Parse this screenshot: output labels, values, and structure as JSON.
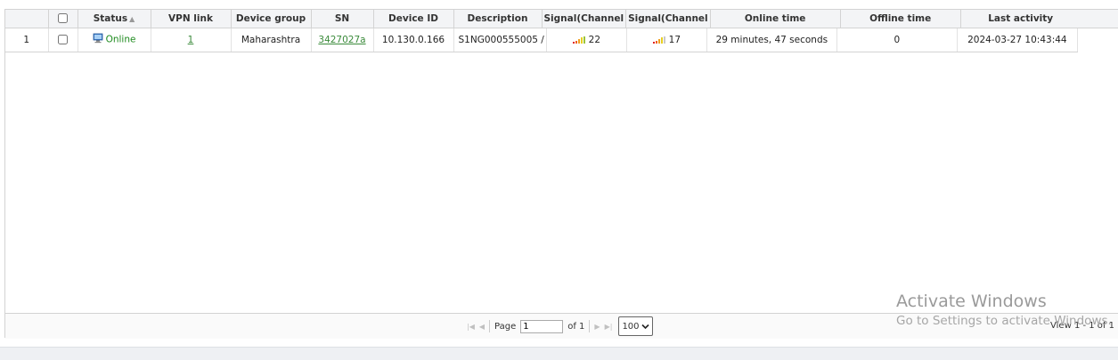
{
  "table": {
    "headers": {
      "num": "",
      "status": "Status",
      "vpn": "VPN link",
      "group": "Device group",
      "sn": "SN",
      "device_id": "Device ID",
      "description": "Description",
      "signal1": "Signal(Channel",
      "signal2": "Signal(Channel",
      "online_time": "Online time",
      "offline_time": "Offline time",
      "last_activity": "Last activity"
    },
    "sort_indicator": "▲",
    "rows": [
      {
        "num": "1",
        "status": "Online",
        "vpn": "1",
        "group": "Maharashtra",
        "sn": "3427027a",
        "device_id": "10.130.0.166",
        "description": "S1NG000555005 /",
        "signal1": "22",
        "signal2": "17",
        "online_time": "29 minutes, 47 seconds",
        "offline_time": "0",
        "last_activity": "2024-03-27 10:43:44"
      }
    ]
  },
  "pager": {
    "page_label": "Page",
    "page_value": "1",
    "of_label": "of 1",
    "page_size": "100",
    "view_info": "View 1 - 1 of 1"
  },
  "watermark": {
    "line1": "Activate Windows",
    "line2": "Go to Settings to activate Windows."
  },
  "colors": {
    "online": "#1e8a1e",
    "link": "#3a8a3a",
    "signal_red": "#e02020",
    "signal_orange": "#f0a020",
    "signal_yellow": "#e8d020",
    "signal_grey": "#c8c8c8"
  },
  "icons": {
    "status": "computer-monitor-icon",
    "sort": "sort-asc-icon",
    "signal": "signal-bars-icon",
    "first": "first-page-icon",
    "prev": "prev-page-icon",
    "next": "next-page-icon",
    "last": "last-page-icon",
    "dropdown": "chevron-down-icon"
  }
}
